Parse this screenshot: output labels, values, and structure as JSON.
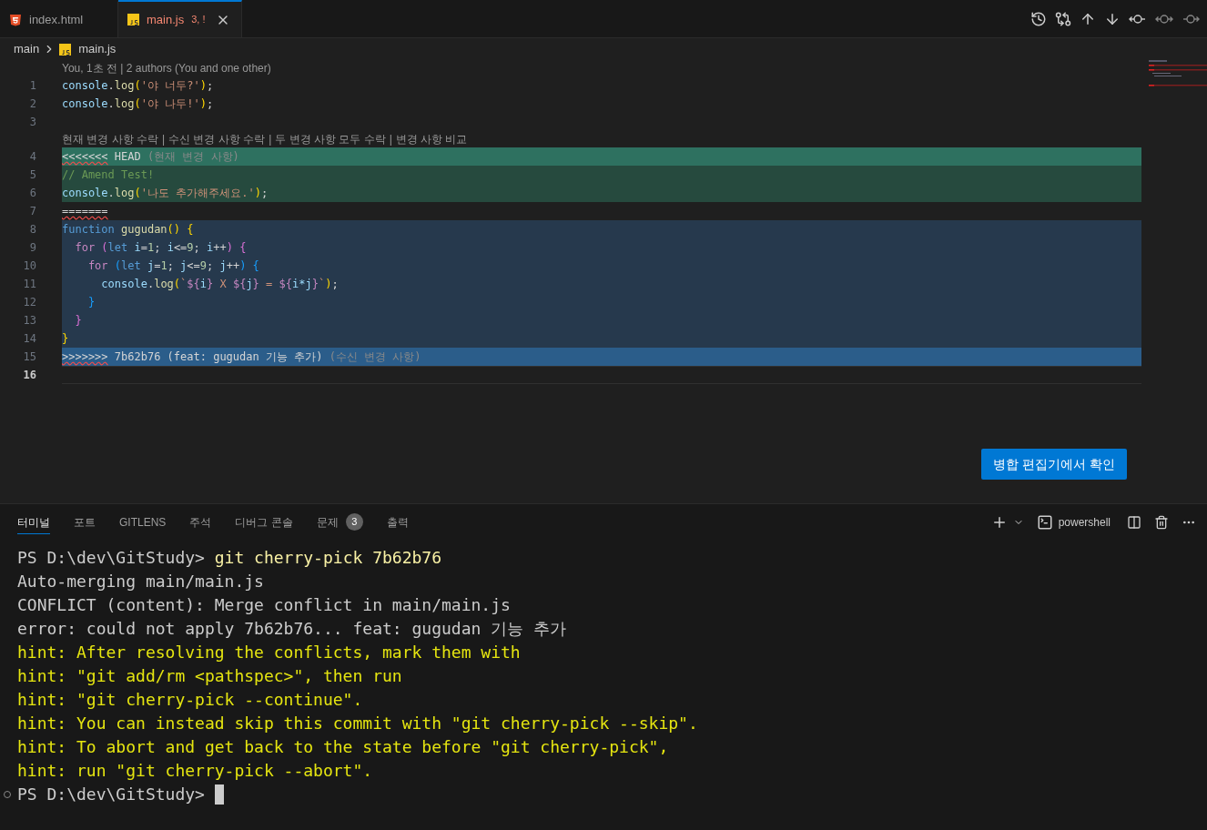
{
  "tabs": [
    {
      "label": "index.html",
      "kind": "html",
      "selected": false
    },
    {
      "label": "main.js",
      "kind": "js",
      "selected": true,
      "badge": "3, !"
    }
  ],
  "breadcrumb": {
    "folder": "main",
    "file": "main.js"
  },
  "blame": "You, 1초 전 | 2 authors (You and one other)",
  "code_lens": [
    "현재 변경 사항 수락",
    "수신 변경 사항 수락",
    "두 변경 사항 모두 수락",
    "변경 사항 비교"
  ],
  "code_lens_separator": "|",
  "lines": [
    {
      "number": "1",
      "kind": "plain",
      "active": false,
      "tokens": [
        {
          "text": "console",
          "kind": "var"
        },
        {
          "text": ".",
          "kind": "plain"
        },
        {
          "text": "log",
          "kind": "fn"
        },
        {
          "text": "(",
          "kind": "brace1"
        },
        {
          "text": "'야 너두?'",
          "kind": "str"
        },
        {
          "text": ")",
          "kind": "brace1"
        },
        {
          "text": ";",
          "kind": "plain"
        }
      ]
    },
    {
      "number": "2",
      "kind": "plain",
      "active": false,
      "tokens": [
        {
          "text": "console",
          "kind": "var"
        },
        {
          "text": ".",
          "kind": "plain"
        },
        {
          "text": "log",
          "kind": "fn"
        },
        {
          "text": "(",
          "kind": "brace1"
        },
        {
          "text": "'야 나두!'",
          "kind": "str"
        },
        {
          "text": ")",
          "kind": "brace1"
        },
        {
          "text": ";",
          "kind": "plain"
        }
      ]
    },
    {
      "number": "3",
      "kind": "plain",
      "active": false
    },
    {
      "number": "4",
      "kind": "current-header",
      "active": false,
      "tokens": [
        {
          "text": "<<<<<<<",
          "kind": "marker"
        },
        {
          "text": " HEAD",
          "kind": "plain"
        },
        {
          "text": " (현재 변경 사항)",
          "kind": "label"
        }
      ]
    },
    {
      "number": "5",
      "kind": "current",
      "active": false,
      "tokens": [
        {
          "text": "// Amend Test!",
          "kind": "comment"
        }
      ]
    },
    {
      "number": "6",
      "kind": "current",
      "active": false,
      "tokens": [
        {
          "text": "console",
          "kind": "var"
        },
        {
          "text": ".",
          "kind": "plain"
        },
        {
          "text": "log",
          "kind": "fn"
        },
        {
          "text": "(",
          "kind": "brace1"
        },
        {
          "text": "'나도 추가해주세요.'",
          "kind": "str"
        },
        {
          "text": ")",
          "kind": "brace1"
        },
        {
          "text": ";",
          "kind": "plain"
        }
      ]
    },
    {
      "number": "7",
      "kind": "plain",
      "active": false,
      "tokens": [
        {
          "text": "=======",
          "kind": "marker"
        }
      ]
    },
    {
      "number": "8",
      "kind": "incoming",
      "active": false,
      "tokens": [
        {
          "text": "function",
          "kind": "keyword"
        },
        {
          "text": " gugudan",
          "kind": "fn"
        },
        {
          "text": "()",
          "kind": "brace1"
        },
        {
          "text": " {",
          "kind": "brace1"
        }
      ]
    },
    {
      "number": "9",
      "kind": "incoming",
      "active": false,
      "tokens": [
        {
          "text": "  for",
          "kind": "control"
        },
        {
          "text": " (",
          "kind": "brace2"
        },
        {
          "text": "let",
          "kind": "keyword"
        },
        {
          "text": " i",
          "kind": "var"
        },
        {
          "text": "=",
          "kind": "plain"
        },
        {
          "text": "1",
          "kind": "num"
        },
        {
          "text": ";",
          "kind": "plain"
        },
        {
          "text": " i",
          "kind": "var"
        },
        {
          "text": "<=",
          "kind": "plain"
        },
        {
          "text": "9",
          "kind": "num"
        },
        {
          "text": ";",
          "kind": "plain"
        },
        {
          "text": " i",
          "kind": "var"
        },
        {
          "text": "++",
          "kind": "plain"
        },
        {
          "text": ")",
          "kind": "brace2"
        },
        {
          "text": " {",
          "kind": "brace2"
        }
      ]
    },
    {
      "number": "10",
      "kind": "incoming",
      "active": false,
      "tokens": [
        {
          "text": "    for",
          "kind": "control"
        },
        {
          "text": " (",
          "kind": "brace3"
        },
        {
          "text": "let",
          "kind": "keyword"
        },
        {
          "text": " j",
          "kind": "var"
        },
        {
          "text": "=",
          "kind": "plain"
        },
        {
          "text": "1",
          "kind": "num"
        },
        {
          "text": ";",
          "kind": "plain"
        },
        {
          "text": " j",
          "kind": "var"
        },
        {
          "text": "<=",
          "kind": "plain"
        },
        {
          "text": "9",
          "kind": "num"
        },
        {
          "text": ";",
          "kind": "plain"
        },
        {
          "text": " j",
          "kind": "var"
        },
        {
          "text": "++",
          "kind": "plain"
        },
        {
          "text": ")",
          "kind": "brace3"
        },
        {
          "text": " {",
          "kind": "brace3"
        }
      ]
    },
    {
      "number": "11",
      "kind": "incoming",
      "active": false,
      "tokens": [
        {
          "text": "      console",
          "kind": "var"
        },
        {
          "text": ".",
          "kind": "plain"
        },
        {
          "text": "log",
          "kind": "fn"
        },
        {
          "text": "(",
          "kind": "brace1"
        },
        {
          "text": "`",
          "kind": "str"
        },
        {
          "text": "${",
          "kind": "control"
        },
        {
          "text": "i",
          "kind": "var"
        },
        {
          "text": "}",
          "kind": "control"
        },
        {
          "text": " X ",
          "kind": "str"
        },
        {
          "text": "${",
          "kind": "control"
        },
        {
          "text": "j",
          "kind": "var"
        },
        {
          "text": "}",
          "kind": "control"
        },
        {
          "text": " = ",
          "kind": "str"
        },
        {
          "text": "${",
          "kind": "control"
        },
        {
          "text": "i*j",
          "kind": "var"
        },
        {
          "text": "}",
          "kind": "control"
        },
        {
          "text": "`",
          "kind": "str"
        },
        {
          "text": ")",
          "kind": "brace1"
        },
        {
          "text": ";",
          "kind": "plain"
        }
      ]
    },
    {
      "number": "12",
      "kind": "incoming",
      "active": false,
      "tokens": [
        {
          "text": "    }",
          "kind": "brace3"
        }
      ]
    },
    {
      "number": "13",
      "kind": "incoming",
      "active": false,
      "tokens": [
        {
          "text": "  }",
          "kind": "brace2"
        }
      ]
    },
    {
      "number": "14",
      "kind": "incoming",
      "active": false,
      "tokens": [
        {
          "text": "}",
          "kind": "brace1"
        }
      ]
    },
    {
      "number": "15",
      "kind": "incoming-header",
      "active": false,
      "tokens": [
        {
          "text": ">>>>>>>",
          "kind": "marker"
        },
        {
          "text": " 7b62b76 (feat: gugudan 기능 추가)",
          "kind": "plain"
        },
        {
          "text": " (수신 변경 사항)",
          "kind": "label"
        }
      ]
    },
    {
      "number": "16",
      "kind": "plain",
      "active": true
    }
  ],
  "merge_button": "병합 편집기에서 확인",
  "panel_tabs": [
    {
      "label": "터미널",
      "selected": true
    },
    {
      "label": "포트",
      "selected": false
    },
    {
      "label": "GITLENS",
      "selected": false
    },
    {
      "label": "주석",
      "selected": false
    },
    {
      "label": "디버그 콘솔",
      "selected": false
    },
    {
      "label": "문제",
      "selected": false,
      "badge": "3"
    },
    {
      "label": "출력",
      "selected": false
    }
  ],
  "terminal_shell": "powershell",
  "terminal": [
    {
      "kind": "command",
      "prompt": "PS D:\\dev\\GitStudy>",
      "command": "git cherry-pick 7b62b76"
    },
    {
      "kind": "output",
      "text": "Auto-merging main/main.js"
    },
    {
      "kind": "output",
      "text": "CONFLICT (content): Merge conflict in main/main.js"
    },
    {
      "kind": "output",
      "text": "error: could not apply 7b62b76... feat: gugudan 기능 추가"
    },
    {
      "kind": "hint",
      "text": "hint: After resolving the conflicts, mark them with"
    },
    {
      "kind": "hint",
      "text": "hint: \"git add/rm <pathspec>\", then run"
    },
    {
      "kind": "hint",
      "text": "hint: \"git cherry-pick --continue\"."
    },
    {
      "kind": "hint",
      "text": "hint: You can instead skip this commit with \"git cherry-pick --skip\"."
    },
    {
      "kind": "hint",
      "text": "hint: To abort and get back to the state before \"git cherry-pick\","
    },
    {
      "kind": "hint",
      "text": "hint: run \"git cherry-pick --abort\"."
    },
    {
      "kind": "prompt",
      "prompt": "PS D:\\dev\\GitStudy>"
    }
  ]
}
